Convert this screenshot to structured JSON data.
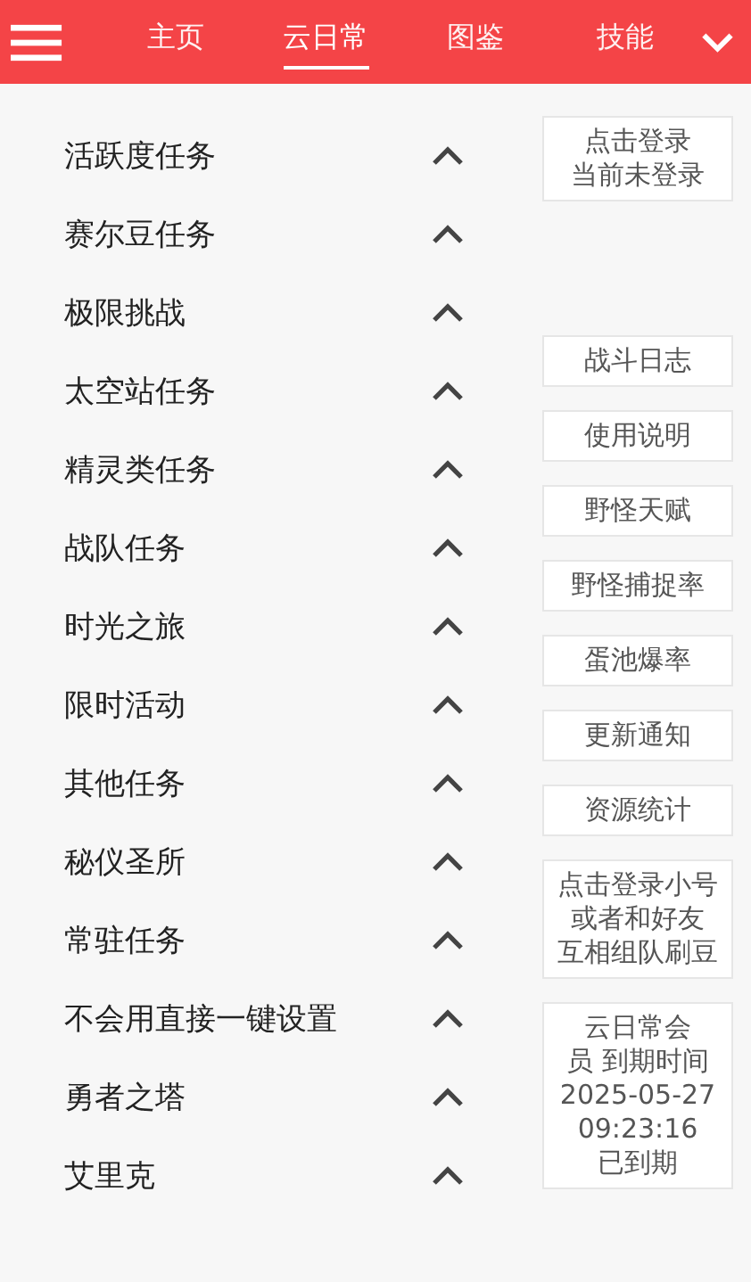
{
  "header": {
    "tabs": [
      {
        "label": "主页",
        "selected": false
      },
      {
        "label": "云日常",
        "selected": true
      },
      {
        "label": "图鉴",
        "selected": false
      },
      {
        "label": "技能",
        "selected": false
      }
    ]
  },
  "tasks": [
    "活跃度任务",
    "赛尔豆任务",
    "极限挑战",
    "太空站任务",
    "精灵类任务",
    "战队任务",
    "时光之旅",
    "限时活动",
    "其他任务",
    "秘仪圣所",
    "常驻任务",
    "不会用直接一键设置",
    "勇者之塔",
    "艾里克"
  ],
  "side_buttons": [
    {
      "lines": [
        "点击登录",
        "当前未登录"
      ]
    },
    {
      "lines": [
        "战斗日志"
      ]
    },
    {
      "lines": [
        "使用说明"
      ]
    },
    {
      "lines": [
        "野怪天赋"
      ]
    },
    {
      "lines": [
        "野怪捕捉率"
      ]
    },
    {
      "lines": [
        "蛋池爆率"
      ]
    },
    {
      "lines": [
        "更新通知"
      ]
    },
    {
      "lines": [
        "资源统计"
      ]
    },
    {
      "lines": [
        "点击登录小号",
        "或者和好友",
        "互相组队刷豆"
      ]
    },
    {
      "lines": [
        "云日常会",
        "员 到期时间",
        "2025-05-27",
        "09:23:16",
        "已到期"
      ]
    }
  ]
}
